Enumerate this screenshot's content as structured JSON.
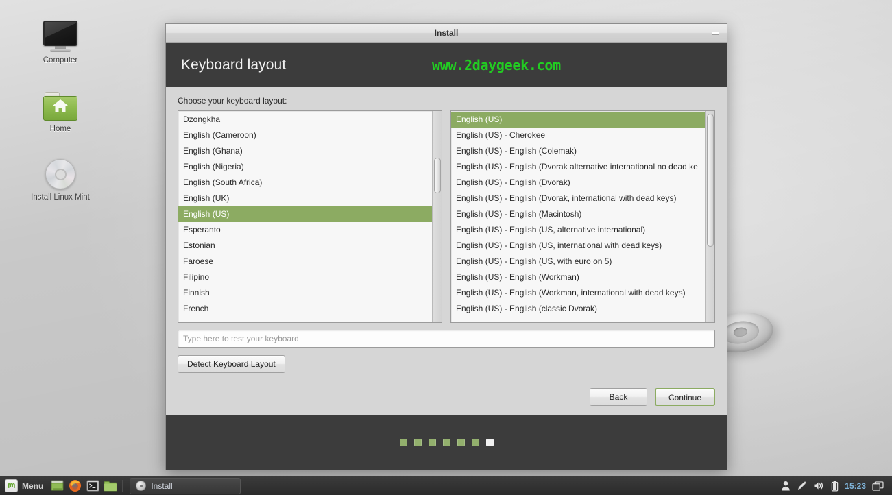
{
  "desktop": {
    "icons": [
      {
        "label": "Computer",
        "icon": "computer-monitor-icon"
      },
      {
        "label": "Home",
        "icon": "home-folder-icon"
      },
      {
        "label": "Install Linux Mint",
        "icon": "cd-disc-icon"
      }
    ]
  },
  "window": {
    "title": "Install",
    "minimize_label": "Minimize",
    "header_title": "Keyboard layout",
    "watermark": "www.2daygeek.com",
    "watermark_color": "#22cc22",
    "header_bg": "#3c3c3c",
    "accent_color": "#8cab62"
  },
  "content": {
    "choose_label": "Choose your keyboard layout:",
    "language_list": {
      "selected": "English (US)",
      "items": [
        "Dzongkha",
        "English (Cameroon)",
        "English (Ghana)",
        "English (Nigeria)",
        "English (South Africa)",
        "English (UK)",
        "English (US)",
        "Esperanto",
        "Estonian",
        "Faroese",
        "Filipino",
        "Finnish",
        "French"
      ]
    },
    "variant_list": {
      "selected": "English (US)",
      "items": [
        "English (US)",
        "English (US) - Cherokee",
        "English (US) - English (Colemak)",
        "English (US) - English (Dvorak alternative international no dead ke",
        "English (US) - English (Dvorak)",
        "English (US) - English (Dvorak, international with dead keys)",
        "English (US) - English (Macintosh)",
        "English (US) - English (US, alternative international)",
        "English (US) - English (US, international with dead keys)",
        "English (US) - English (US, with euro on 5)",
        "English (US) - English (Workman)",
        "English (US) - English (Workman, international with dead keys)",
        "English (US) - English (classic Dvorak)"
      ]
    },
    "test_input": {
      "placeholder": "Type here to test your keyboard",
      "value": ""
    },
    "detect_button": "Detect Keyboard Layout",
    "back_button": "Back",
    "continue_button": "Continue"
  },
  "progress": {
    "total_steps": 7,
    "current_step": 7,
    "done_color": "#93b06d",
    "current_color": "#f0f0f0"
  },
  "taskbar": {
    "menu_label": "Menu",
    "quick_launch": [
      {
        "name": "show-desktop-icon"
      },
      {
        "name": "firefox-icon"
      },
      {
        "name": "terminal-icon"
      },
      {
        "name": "file-manager-icon"
      }
    ],
    "task_button": "Install",
    "tray": [
      {
        "name": "user-icon"
      },
      {
        "name": "update-manager-icon"
      },
      {
        "name": "volume-icon"
      },
      {
        "name": "battery-icon"
      }
    ],
    "clock": "15:23",
    "workspace_switcher": "workspace-switcher-icon"
  }
}
